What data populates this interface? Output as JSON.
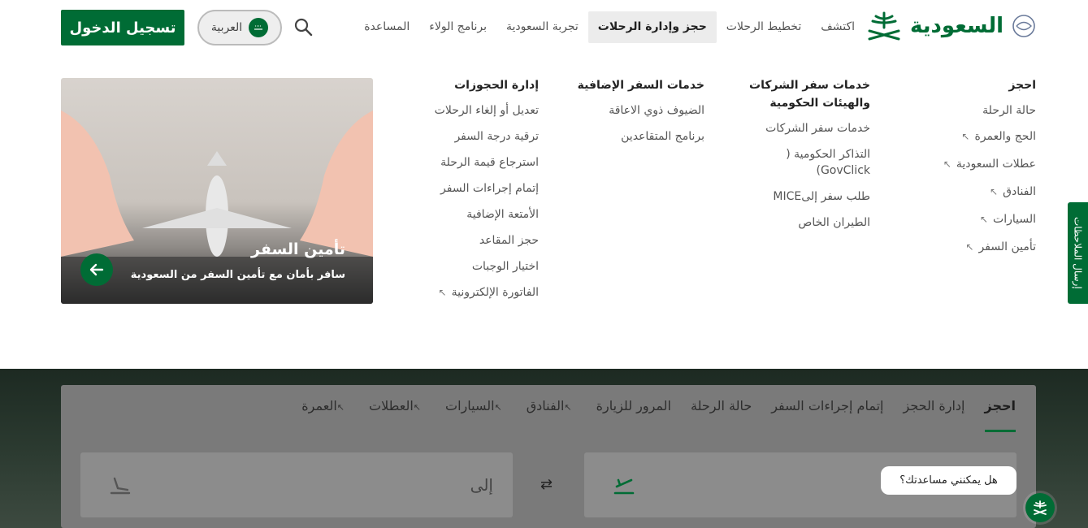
{
  "header": {
    "logo_text": "السعودية",
    "nav": [
      "اكتشف",
      "تخطيط الرحلات",
      "حجز وإدارة الرحلات",
      "تجربة السعودية",
      "برنامج الولاء",
      "المساعدة"
    ],
    "active_nav_index": 2,
    "language_label": "العربية",
    "login_label": "تسجيل الدخول"
  },
  "menu": {
    "columns": [
      {
        "title": "احجز",
        "items": [
          {
            "label": "حالة الرحلة",
            "external": false
          },
          {
            "label": "الحج والعمرة",
            "external": true
          },
          {
            "label": "عطلات السعودية",
            "external": true
          },
          {
            "label": "الفنادق",
            "external": true
          },
          {
            "label": "السيارات",
            "external": true
          },
          {
            "label": "تأمين السفر",
            "external": true
          }
        ]
      },
      {
        "title": "خدمات سفر الشركات والهيئات الحكومية",
        "items": [
          {
            "label": "خدمات سفر الشركات",
            "external": false
          },
          {
            "label": "التذاكر الحكومية ( GovClick)",
            "external": false
          },
          {
            "label": "طلب سفر إلىMICE",
            "external": false
          },
          {
            "label": "الطيران الخاص",
            "external": false
          }
        ]
      },
      {
        "title": "خدمات السفر الإضافية",
        "items": [
          {
            "label": "الضيوف ذوي الاعاقة",
            "external": false
          },
          {
            "label": "برنامج المتقاعدين",
            "external": false
          }
        ]
      },
      {
        "title": "إدارة الحجوزات",
        "items": [
          {
            "label": "تعديل أو إلغاء الرحلات",
            "external": false
          },
          {
            "label": "ترقية درجة السفر",
            "external": false
          },
          {
            "label": "استرجاع قيمة الرحلة",
            "external": false
          },
          {
            "label": "إتمام إجراءات السفر",
            "external": false
          },
          {
            "label": "الأمتعة الإضافية",
            "external": false
          },
          {
            "label": "حجز المقاعد",
            "external": false
          },
          {
            "label": "اختيار الوجبات",
            "external": false
          },
          {
            "label": "الفاتورة الإلكترونية",
            "external": true
          }
        ]
      }
    ],
    "promo": {
      "title": "تأمين السفر",
      "subtitle": "سافر بأمان مع تأمين السفر من السعودية"
    }
  },
  "feedback_label": "إرسال الملاحظات",
  "booking": {
    "tabs": [
      {
        "label": "احجز",
        "external": false
      },
      {
        "label": "إدارة الحجز",
        "external": false
      },
      {
        "label": "إتمام إجراءات السفر",
        "external": false
      },
      {
        "label": "حالة الرحلة",
        "external": false
      },
      {
        "label": "المرور للزيارة",
        "external": false
      },
      {
        "label": "الفنادق",
        "external": true
      },
      {
        "label": "السيارات",
        "external": true
      },
      {
        "label": "العطلات",
        "external": true
      },
      {
        "label": "العمرة",
        "external": true
      }
    ],
    "active_tab_index": 0,
    "to_label": "إلى"
  },
  "chat": {
    "bubble_text": "هل يمكنني مساعدتك؟"
  },
  "colors": {
    "brand_green": "#006c35",
    "active_nav_bg": "#ececec"
  }
}
